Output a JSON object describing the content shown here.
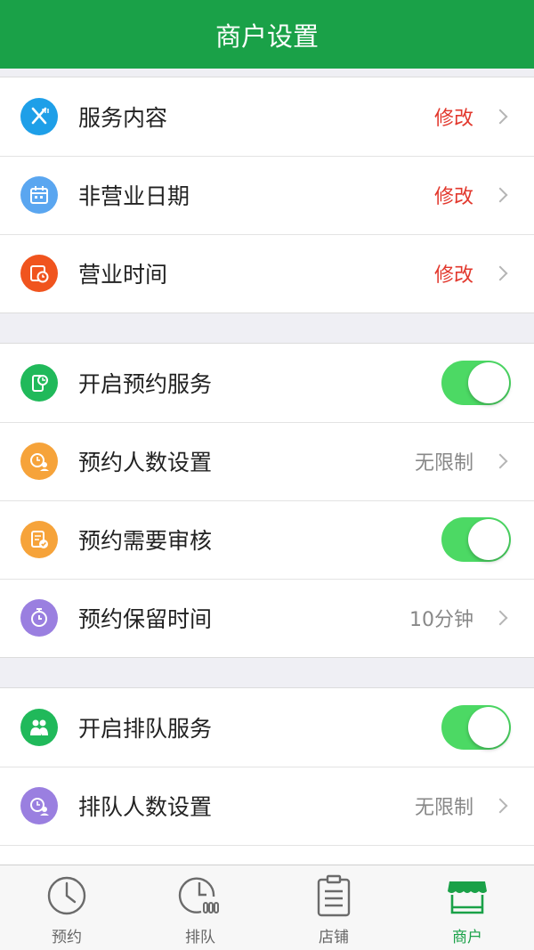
{
  "header": {
    "title": "商户设置"
  },
  "colors": {
    "brand": "#1aa148",
    "toggle_on": "#4cd964",
    "edit_red": "#e2382d"
  },
  "group_business": {
    "rows": [
      {
        "label": "服务内容",
        "value": "修改",
        "icon": "fork-knife-icon"
      },
      {
        "label": "非营业日期",
        "value": "修改",
        "icon": "calendar-icon"
      },
      {
        "label": "营业时间",
        "value": "修改",
        "icon": "schedule-clock-icon"
      }
    ]
  },
  "group_reservation": {
    "rows": [
      {
        "label": "开启预约服务",
        "toggle": true,
        "icon": "phone-chart-icon"
      },
      {
        "label": "预约人数设置",
        "value": "无限制",
        "icon": "people-clock-icon"
      },
      {
        "label": "预约需要审核",
        "toggle": true,
        "icon": "document-check-icon"
      },
      {
        "label": "预约保留时间",
        "value": "10分钟",
        "icon": "stopwatch-icon"
      }
    ]
  },
  "group_queue": {
    "rows": [
      {
        "label": "开启排队服务",
        "toggle": true,
        "icon": "group-people-icon"
      },
      {
        "label": "排队人数设置",
        "value": "无限制",
        "icon": "people-clock-icon"
      }
    ]
  },
  "tabbar": {
    "tabs": [
      {
        "label": "预约",
        "icon": "clock-icon",
        "active": false
      },
      {
        "label": "排队",
        "icon": "queue-clock-icon",
        "active": false
      },
      {
        "label": "店铺",
        "icon": "clipboard-icon",
        "active": false
      },
      {
        "label": "商户",
        "icon": "storefront-icon",
        "active": true
      }
    ]
  }
}
